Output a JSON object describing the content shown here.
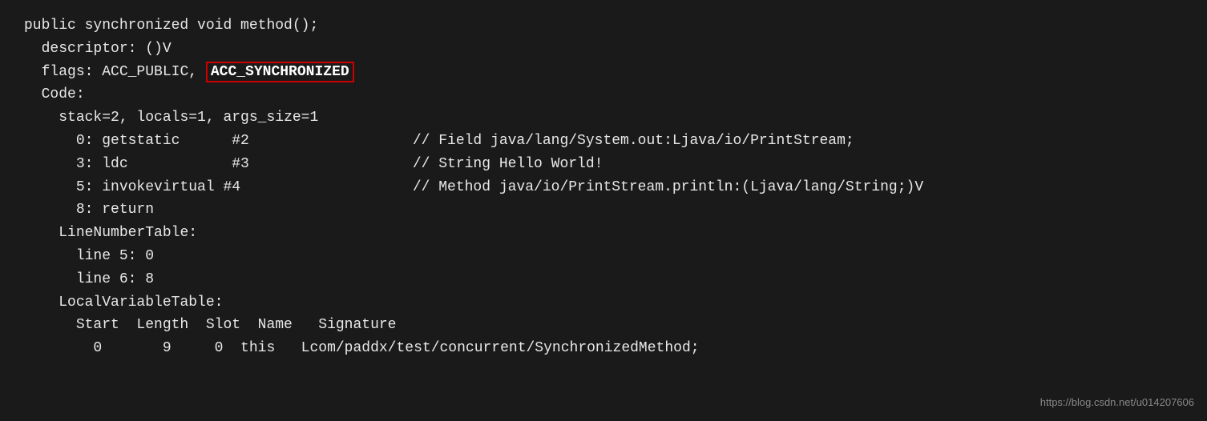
{
  "code": {
    "lines": [
      {
        "id": "line1",
        "text": "public synchronized void method();"
      },
      {
        "id": "line2",
        "indent": "  ",
        "text": "descriptor: ()V"
      },
      {
        "id": "line3",
        "indent": "  ",
        "prefix": "flags: ACC_PUBLIC, ",
        "highlight": "ACC_SYNCHRONIZED",
        "suffix": ""
      },
      {
        "id": "line4",
        "indent": "  ",
        "text": "Code:"
      },
      {
        "id": "line5",
        "indent": "    ",
        "text": "stack=2, locals=1, args_size=1"
      },
      {
        "id": "line6",
        "indent": "      ",
        "col1": "0: getstatic",
        "col2": "#2",
        "comment": "// Field java/lang/System.out:Ljava/io/PrintStream;"
      },
      {
        "id": "line7",
        "indent": "      ",
        "col1": "3: ldc",
        "col2": "#3",
        "comment": "// String Hello World!"
      },
      {
        "id": "line8",
        "indent": "      ",
        "col1": "5: invokevirtual #4",
        "col2": "",
        "comment": "// Method java/io/PrintStream.println:(Ljava/lang/String;)V"
      },
      {
        "id": "line9",
        "indent": "      ",
        "text": "8: return"
      },
      {
        "id": "line10",
        "indent": "    ",
        "text": "LineNumberTable:"
      },
      {
        "id": "line11",
        "indent": "      ",
        "text": "line 5: 0"
      },
      {
        "id": "line12",
        "indent": "      ",
        "text": "line 6: 8"
      },
      {
        "id": "line13",
        "indent": "    ",
        "text": "LocalVariableTable:"
      },
      {
        "id": "line14",
        "indent": "      ",
        "text": "Start  Length  Slot  Name   Signature"
      },
      {
        "id": "line15",
        "indent": "        ",
        "text": "0       9     0  this   Lcom/paddx/test/concurrent/SynchronizedMethod;"
      }
    ],
    "watermark": "https://blog.csdn.net/u014207606"
  }
}
